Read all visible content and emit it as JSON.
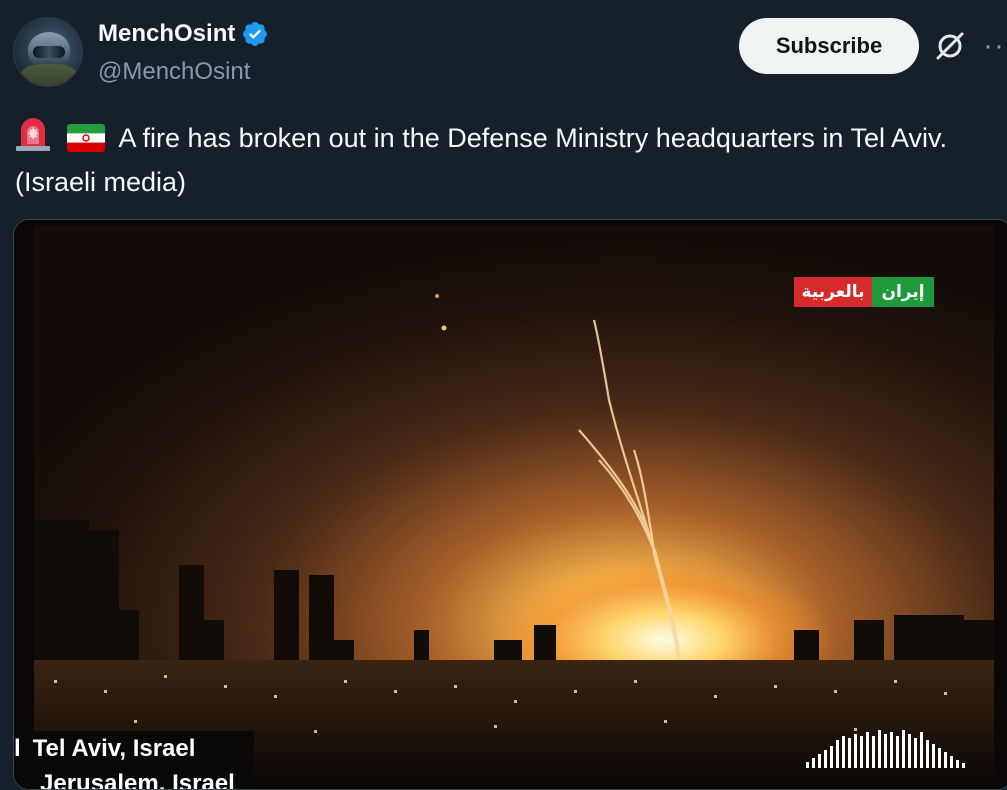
{
  "author": {
    "display_name": "MenchOsint",
    "handle": "@MenchOsint",
    "verified": true,
    "avatar": "pilot-helmet-avatar"
  },
  "header_actions": {
    "subscribe_label": "Subscribe",
    "grok_icon": "grok-icon",
    "more_icon": "more-icon"
  },
  "tweet": {
    "emojis": [
      "rotating-light-siren",
      "iran-flag"
    ],
    "text": "A fire has broken out in the Defense Ministry headquarters in Tel Aviv. (Israeli media)"
  },
  "media": {
    "description_icon": "video-frame",
    "channel_logo_red": "بالعربية",
    "channel_logo_green": "إيران",
    "caption_bar": "l",
    "caption_line1": "Tel Aviv, Israel",
    "caption_line2": "Jerusalem, Israel",
    "audio_meter_icon": "audio-level-icon"
  },
  "colors": {
    "background": "#15202b",
    "verified_blue": "#1d9bf0",
    "muted_text": "#8b98a5",
    "subscribe_bg": "#eff3f4"
  }
}
